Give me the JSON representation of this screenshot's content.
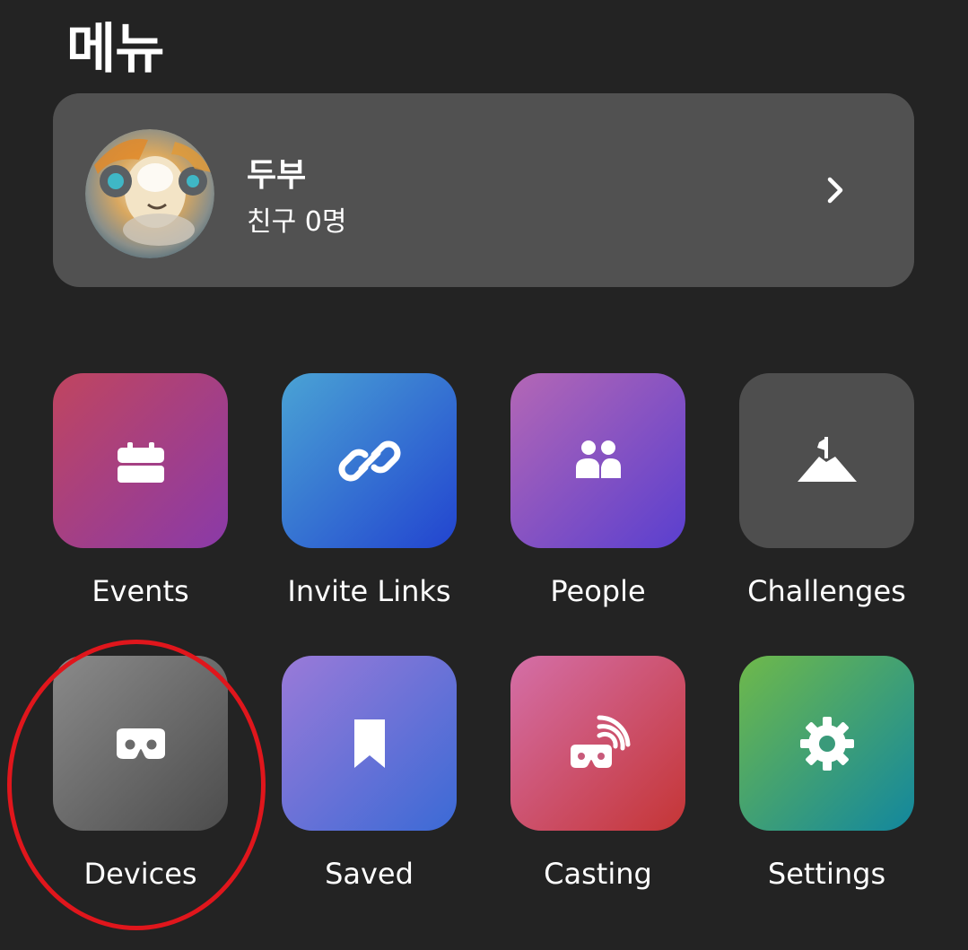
{
  "header": {
    "title": "메뉴"
  },
  "profile": {
    "name": "두부",
    "friends": "친구 0명"
  },
  "menu": {
    "items": [
      {
        "label": "Events",
        "icon": "calendar-icon",
        "gradient": [
          "#c0455f",
          "#8a3aa8"
        ]
      },
      {
        "label": "Invite Links",
        "icon": "link-icon",
        "gradient": [
          "#4aa3d4",
          "#2244d0"
        ]
      },
      {
        "label": "People",
        "icon": "people-icon",
        "gradient": [
          "#b467b5",
          "#5a3fcf"
        ]
      },
      {
        "label": "Challenges",
        "icon": "mountain-flag-icon",
        "gradient": [
          "#4e4e4e",
          "#4e4e4e"
        ]
      },
      {
        "label": "Devices",
        "icon": "vr-headset-icon",
        "gradient": [
          "#8a8a8a",
          "#4c4c4c"
        ]
      },
      {
        "label": "Saved",
        "icon": "bookmark-icon",
        "gradient": [
          "#9a7ad8",
          "#3b6ad6"
        ]
      },
      {
        "label": "Casting",
        "icon": "cast-headset-icon",
        "gradient": [
          "#d46fa8",
          "#c53535"
        ]
      },
      {
        "label": "Settings",
        "icon": "gear-icon",
        "gradient": [
          "#6fb94a",
          "#12879e"
        ]
      }
    ]
  },
  "annotation": {
    "color": "#e0161c",
    "target": "Devices"
  }
}
